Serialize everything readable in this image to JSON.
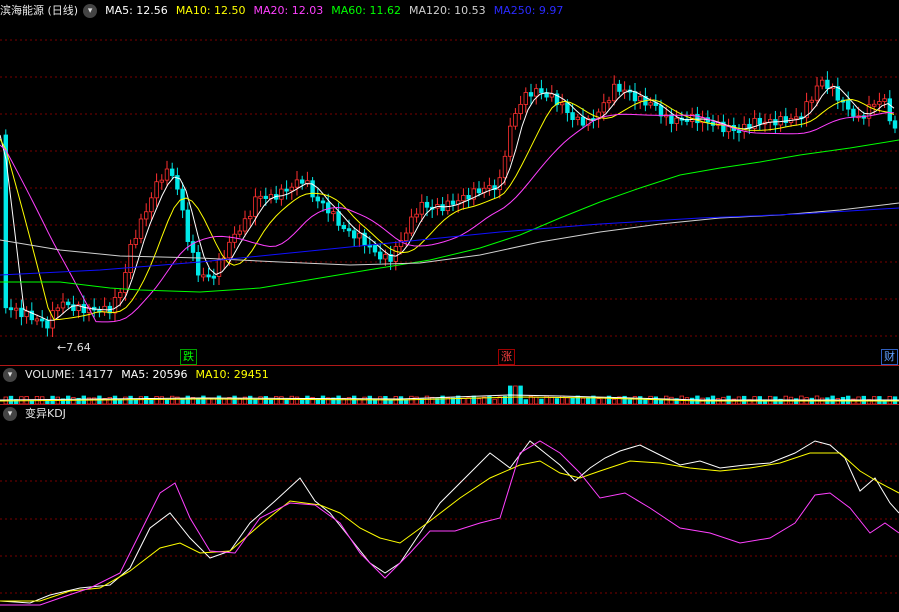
{
  "colors": {
    "up": "#ff3030",
    "down": "#00e8e8",
    "ma5": "#ffffff",
    "ma10": "#ffff00",
    "ma20": "#ff40ff",
    "ma60": "#00ff00",
    "ma120": "#d0d0d0",
    "ma250": "#1010ff",
    "grid": "#7a0000"
  },
  "price": {
    "title": "滨海能源 (日线)",
    "icon": "chevron-down-icon",
    "ma5": "MA5: 12.56",
    "ma10": "MA10: 12.50",
    "ma20": "MA20: 12.03",
    "ma60": "MA60: 11.62",
    "ma120": "MA120: 10.53",
    "ma250": "MA250: 9.97",
    "low_label": "←7.64",
    "events": [
      "跌",
      "涨",
      "财"
    ]
  },
  "volume": {
    "label": "VOLUME: 14177",
    "ma5": "MA5: 20596",
    "ma10": "MA10: 29451"
  },
  "kdj": {
    "title": "变异KDJ"
  }
}
